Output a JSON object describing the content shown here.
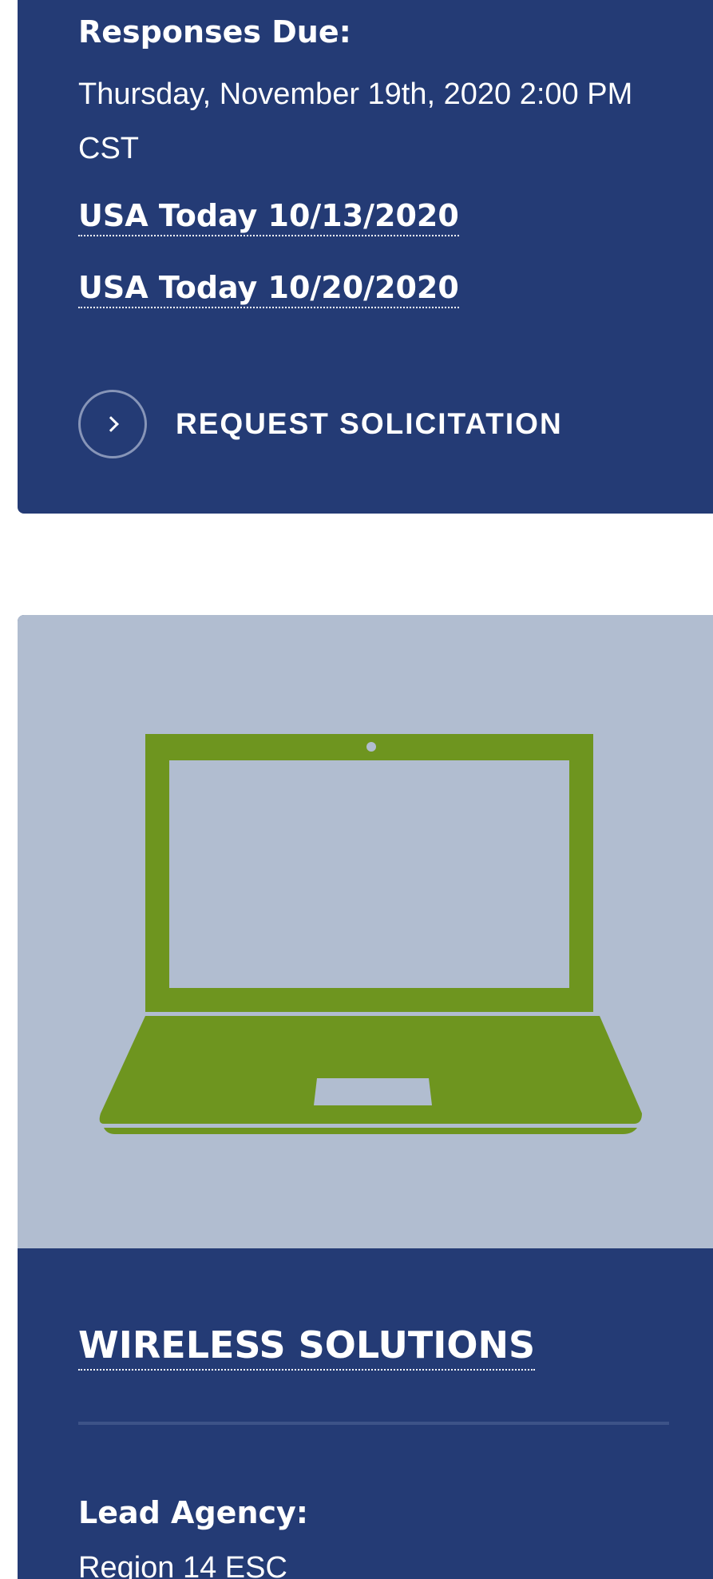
{
  "card1": {
    "responses_due_label": "Responses Due:",
    "responses_due_value": "Thursday, November 19th, 2020 2:00 PM CST",
    "links": [
      {
        "label": "USA Today 10/13/2020"
      },
      {
        "label": "USA Today 10/20/2020"
      }
    ],
    "request_button_label": "REQUEST SOLICITATION",
    "request_icon": "chevron-right-icon"
  },
  "card2": {
    "image_icon": "laptop-icon",
    "title": "WIRELESS SOLUTIONS",
    "lead_agency_label": "Lead Agency:",
    "lead_agency_value": "Region 14 ESC"
  },
  "colors": {
    "card_background": "#243b75",
    "image_background": "#b1bdd0",
    "laptop_green": "#6e951f",
    "text": "#ffffff"
  }
}
